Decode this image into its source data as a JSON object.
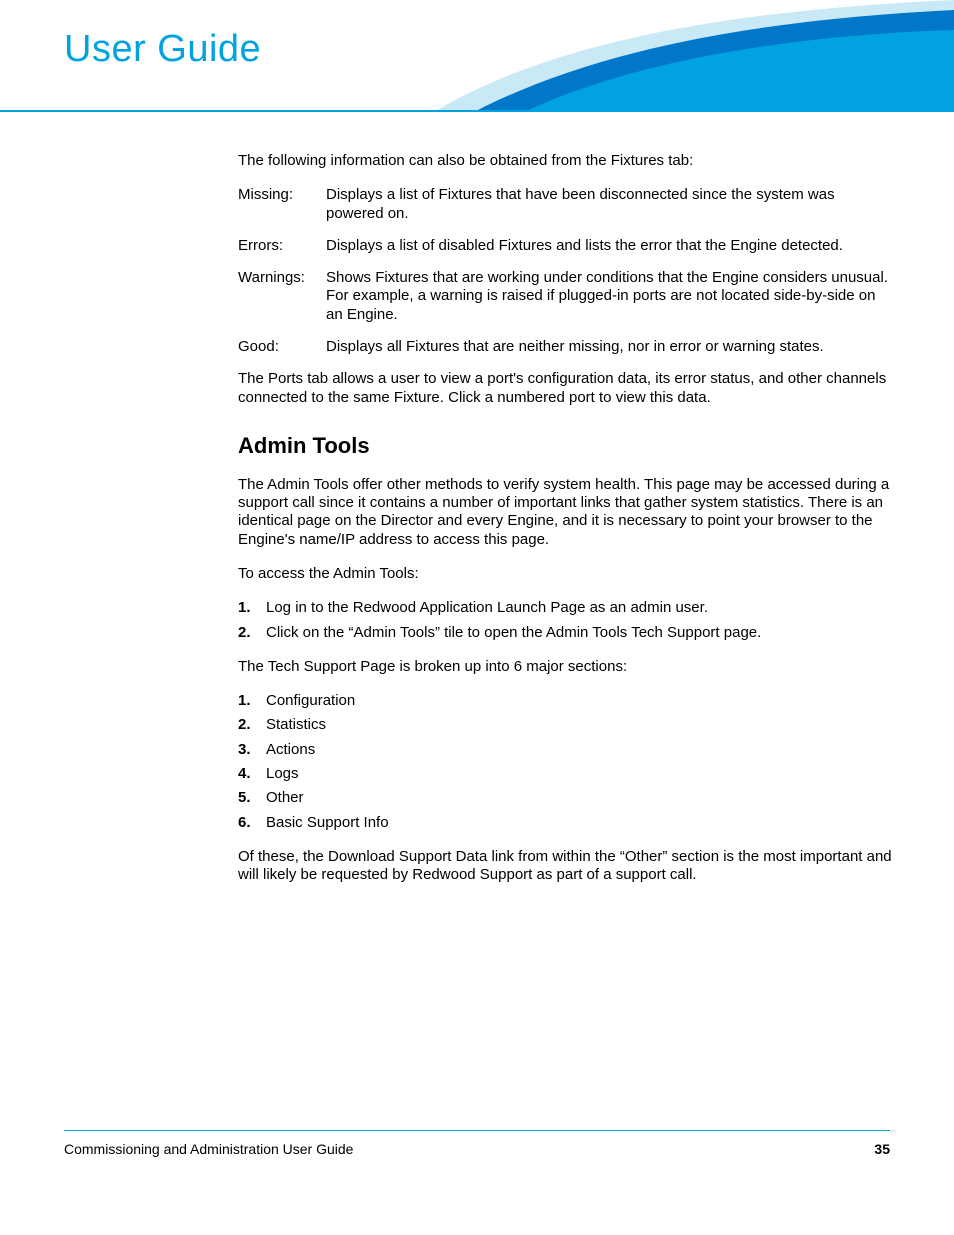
{
  "header": {
    "title": "User Guide"
  },
  "intro": "The following information can also be obtained from the Fixtures tab:",
  "defs": [
    {
      "label": "Missing:",
      "desc": "Displays a list of Fixtures that have been disconnected since the system was powered on."
    },
    {
      "label": "Errors:",
      "desc": "Displays a list of disabled Fixtures and lists the error that the Engine detected."
    },
    {
      "label": "Warnings:",
      "desc": "Shows Fixtures that are working under conditions that the Engine considers unusual. For example, a warning is raised if plugged-in ports are not located side-by-side on an Engine."
    },
    {
      "label": "Good:",
      "desc": "Displays all Fixtures that are neither missing, nor in error or warning states."
    }
  ],
  "ports_para": "The Ports tab allows a user to view a port's configuration data, its error status, and other channels connected to the same Fixture. Click a numbered port to view this data.",
  "section": {
    "heading": "Admin Tools",
    "p1": "The Admin Tools offer other methods to verify system health. This page may be accessed during a support call since it contains a number of important links that gather system statistics. There is an identical page on the Director and every Engine, and it is necessary to point your browser to the Engine's name/IP address to access this page.",
    "p2": "To access the Admin Tools:",
    "steps": [
      "Log in to the Redwood Application Launch Page as an admin user.",
      "Click on the “Admin Tools” tile to open the Admin Tools Tech Support page."
    ],
    "p3": "The Tech Support Page is broken up into 6 major sections:",
    "sections_list": [
      "Configuration",
      "Statistics",
      "Actions",
      "Logs",
      "Other",
      "Basic Support Info"
    ],
    "p4": "Of these, the Download Support Data link from within the “Other” section is the most important and will likely be requested by Redwood Support as part of a support call."
  },
  "footer": {
    "doc": "Commissioning and Administration User Guide",
    "page": "35"
  }
}
